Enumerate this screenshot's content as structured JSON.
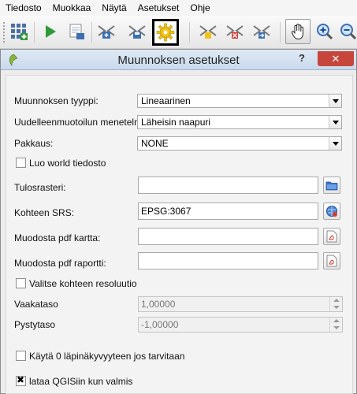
{
  "menu": [
    "Tiedosto",
    "Muokkaa",
    "Näytä",
    "Asetukset",
    "Ohje"
  ],
  "toolbar": {
    "icons": [
      "batch-mode-icon",
      "run-icon",
      "script-icon",
      "raster-add-icon",
      "raster-save-icon",
      "settings-gear-icon",
      "raster-new-icon",
      "raster-remove-icon",
      "raster-export-icon",
      "pan-hand-icon",
      "zoom-in-icon",
      "zoom-out-icon"
    ]
  },
  "dialog": {
    "title": "Muunnoksen asetukset",
    "help": "?",
    "close": "✕"
  },
  "form": {
    "transform_type_label": "Muunnoksen tyyppi:",
    "transform_type_value": "Lineaarinen",
    "resampling_label": "Uudelleenmuotoilun menetelmä:",
    "resampling_value": "Läheisin naapuri",
    "compression_label": "Pakkaus:",
    "compression_value": "NONE",
    "world_file_label": "Luo world tiedosto",
    "output_raster_label": "Tulosrasteri:",
    "output_raster_value": "",
    "target_srs_label": "Kohteen SRS:",
    "target_srs_value": "EPSG:3067",
    "pdf_map_label": "Muodosta pdf kartta:",
    "pdf_map_value": "",
    "pdf_report_label": "Muodosta pdf raportti:",
    "pdf_report_value": "",
    "target_resolution_label": "Valitse kohteen resoluutio",
    "horizontal_label": "Vaakataso",
    "horizontal_value": "1,00000",
    "vertical_label": "Pystytaso",
    "vertical_value": "-1,00000",
    "transparency_label": "Käytä 0 läpinäkyvyyteen jos tarvitaan",
    "load_label": "lataa QGISiin kun valmis"
  },
  "checkbox_state": {
    "world_file": false,
    "target_resolution": false,
    "transparency": false,
    "load_in_qgis": true
  },
  "colors": {
    "close_button": "#c7463c",
    "titlebar": "#c9d9ec",
    "gear": "#f0c419"
  }
}
